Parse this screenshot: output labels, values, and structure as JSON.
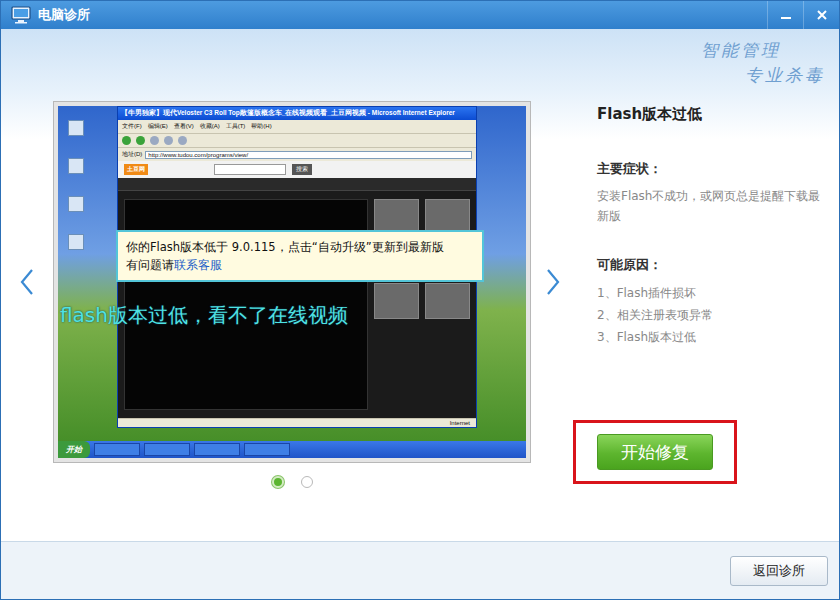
{
  "window": {
    "title": "电脑诊所"
  },
  "slogan": [
    "智能管理",
    "专业杀毒"
  ],
  "carousel": {
    "slides": [
      {
        "selected": true
      },
      {
        "selected": false
      }
    ],
    "screenshot": {
      "browser_title": "【牛男独家】现代Veloster C3 Roll Top敞篷版概念车_在线视频观看_土豆网视频 - Microsoft Internet Explorer",
      "menu": [
        "文件(F)",
        "编辑(E)",
        "查看(V)",
        "收藏(A)",
        "工具(T)",
        "帮助(H)"
      ],
      "address_label": "地址(D)",
      "address": "http://www.tudou.com/programs/view/",
      "site_logo": "土豆网",
      "search_button": "搜索",
      "status": "Internet",
      "start_button": "开始",
      "tooltip": {
        "line1": "你的Flash版本低于 9.0.115，点击“自动升级”更新到最新版",
        "line2": "有问题请",
        "link": "联系客服"
      },
      "caption": "flash版本过低，看不了在线视频"
    }
  },
  "issue": {
    "title": "Flash版本过低",
    "symptom_label": "主要症状：",
    "symptom": "安装Flash不成功，或网页总是提醒下载最新版",
    "cause_label": "可能原因：",
    "causes": [
      "1、Flash插件损坏",
      "2、相关注册表项异常",
      "3、Flash版本过低"
    ]
  },
  "fix_button": {
    "label": "开始修复",
    "highlighted": true
  },
  "footer": {
    "back_button": "返回诊所"
  }
}
